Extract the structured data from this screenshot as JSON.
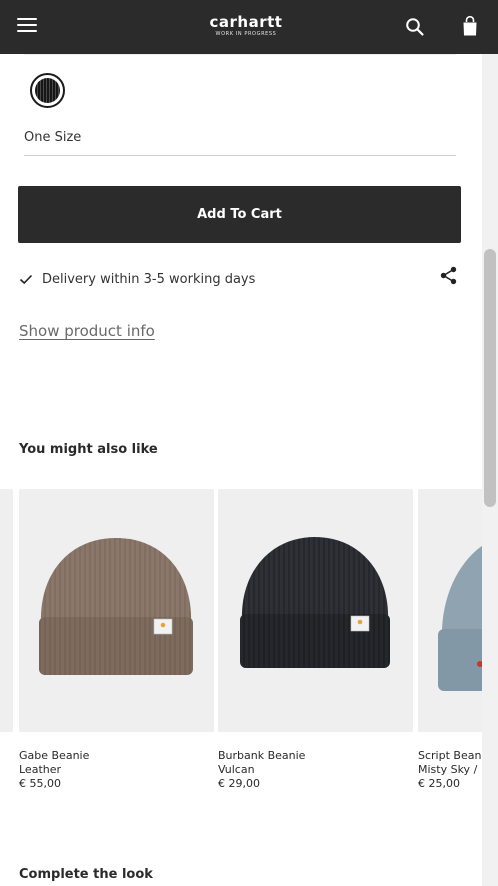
{
  "header": {
    "logo_text": "carhartt",
    "logo_subtext": "WORK IN PROGRESS",
    "menu_icon": "hamburger-menu-icon",
    "search_icon": "search-icon",
    "bag_icon": "shopping-bag-icon"
  },
  "product": {
    "color_swatch_icon": "color-swatch",
    "size_value": "One Size",
    "add_to_cart_label": "Add To Cart",
    "delivery_text": "Delivery within 3-5 working days",
    "share_icon": "share-icon",
    "show_info_label": "Show product info"
  },
  "recommendations": {
    "title": "You might also like",
    "items": [
      {
        "name": "Gabe Beanie",
        "color": "Leather",
        "price": "€ 55,00",
        "swatch": "#8a7769"
      },
      {
        "name": "Burbank Beanie",
        "color": "Vulcan",
        "price": "€ 29,00",
        "swatch": "#2e3036"
      },
      {
        "name": "Script Beanie",
        "color": "Misty Sky / ",
        "price": "€ 25,00",
        "swatch": "#8fa3b1"
      }
    ]
  },
  "complete_the_look": {
    "title": "Complete the look"
  },
  "colors": {
    "header_bg": "#2b2b2b",
    "button_bg": "#2b2b2b",
    "card_bg": "#efefef"
  }
}
